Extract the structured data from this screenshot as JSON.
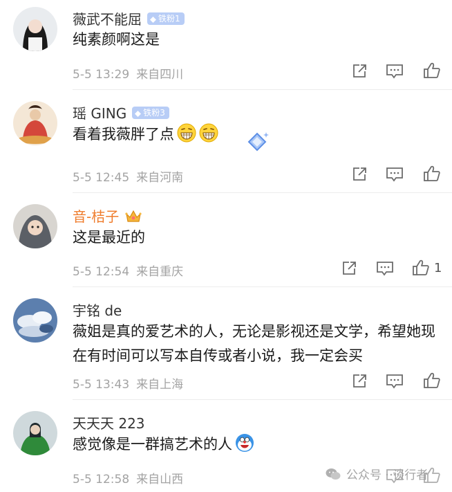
{
  "comments": [
    {
      "username": "薇武不能屈",
      "badge": "铁粉1",
      "text": "纯素颜啊这是",
      "date": "5-5 13:29",
      "location": "来自四川",
      "likes": ""
    },
    {
      "username": "瑶 GING",
      "badge": "铁粉3",
      "text": "看着我薇胖了点",
      "date": "5-5 12:45",
      "location": "来自河南",
      "likes": ""
    },
    {
      "username": "音-桔子",
      "badge": "",
      "text": "这是最近的",
      "date": "5-5 12:54",
      "location": "来自重庆",
      "likes": "1"
    },
    {
      "username": "宇铭 de",
      "badge": "",
      "text": "薇姐是真的爱艺术的人，无论是影视还是文学，希望她现在有时间可以写本自传或者小说，我一定会买",
      "date": "5-5 13:43",
      "location": "来自上海",
      "likes": ""
    },
    {
      "username": "天天天 223",
      "badge": "",
      "text": "感觉像是一群搞艺术的人",
      "date": "5-5 12:58",
      "location": "来自山西",
      "likes": ""
    }
  ],
  "watermark": "公众号 · 谈行者",
  "icons": [
    "repost-icon",
    "comment-icon",
    "like-icon",
    "crown-icon",
    "grin-emoji-icon",
    "robot-emoji-icon",
    "wechat-icon"
  ],
  "colors": {
    "username_highlight": "#ef7c2c",
    "badge": "#b8cdf6",
    "meta": "#a3a3a3"
  }
}
